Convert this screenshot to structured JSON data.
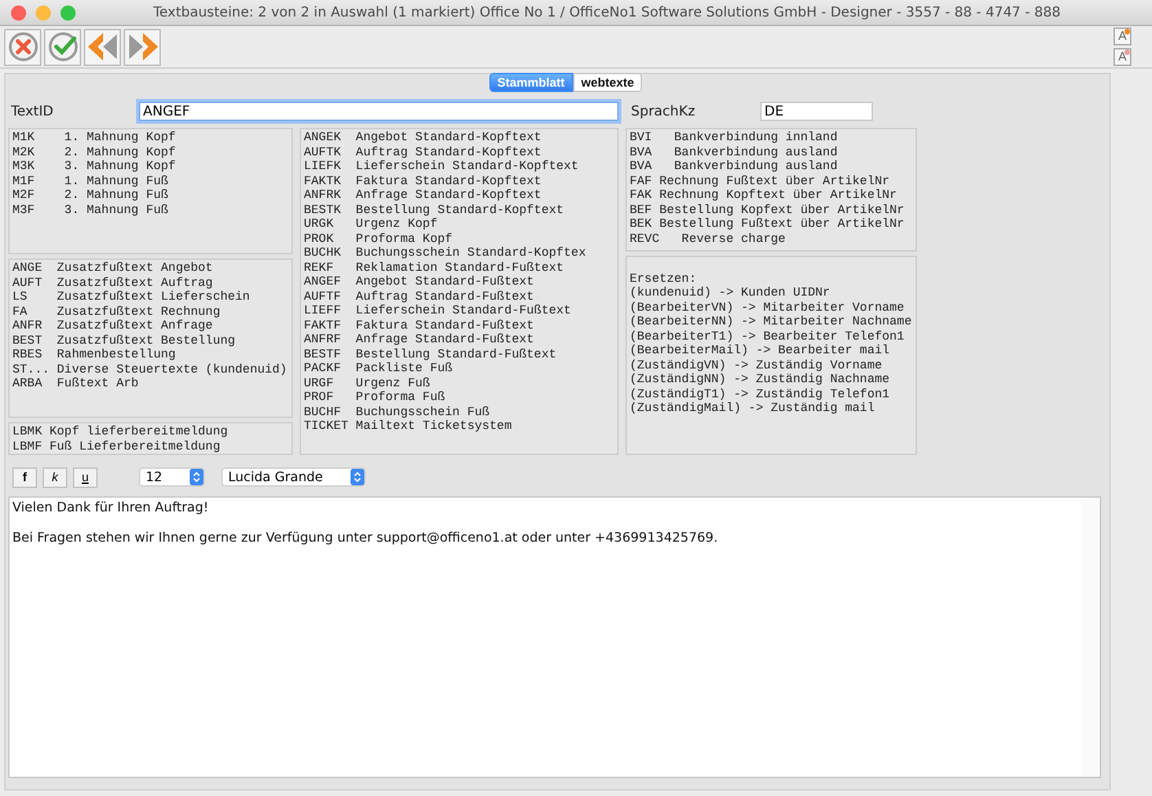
{
  "window": {
    "title": "Textbausteine: 2 von 2 in Auswahl  (1 markiert) Office No 1 /  OfficeNo1 Software Solutions GmbH - Designer - 3557 - 88 - 4747 - 888"
  },
  "toolbar": {
    "actions": [
      {
        "kind": "cancel"
      },
      {
        "kind": "ok"
      },
      {
        "kind": "previous"
      },
      {
        "kind": "next"
      }
    ],
    "font_size_buttons": [
      {
        "label": "A",
        "kind": "increase"
      },
      {
        "label": "A",
        "kind": "decrease"
      }
    ]
  },
  "tabs": [
    {
      "label": "Stammblatt",
      "selected": true
    },
    {
      "label": "webtexte",
      "selected": false
    }
  ],
  "textid": {
    "label": "TextID",
    "value": "ANGEF"
  },
  "sprachkz": {
    "label": "SprachKz",
    "value": "DE"
  },
  "lists": [
    {
      "groups": [
        {
          "lines": [
            "M1K    1. Mahnung Kopf",
            "M2K    2. Mahnung Kopf",
            "M3K    3. Mahnung Kopf",
            "M1F    1. Mahnung Fuß",
            "M2F    2. Mahnung Fuß",
            "M3F    3. Mahnung Fuß"
          ]
        },
        {
          "lines": [
            "ANGE  Zusatzfußtext Angebot",
            "AUFT  Zusatzfußtext Auftrag",
            "LS    Zusatzfußtext Lieferschein",
            "FA    Zusatzfußtext Rechnung",
            "ANFR  Zusatzfußtext Anfrage",
            "BEST  Zusatzfußtext Bestellung",
            "RBES  Rahmenbestellung",
            "ST... Diverse Steuertexte (kundenuid)",
            "ARBA  Fußtext Arb"
          ]
        },
        {
          "lines": [
            "LBMK Kopf lieferbereitmeldung",
            "LBMF Fuß Lieferbereitmeldung"
          ]
        }
      ]
    },
    {
      "groups": [
        {
          "lines": [
            "ANGEK  Angebot Standard-Kopftext",
            "AUFTK  Auftrag Standard-Kopftext",
            "LIEFK  Lieferschein Standard-Kopftext",
            "FAKTK  Faktura Standard-Kopftext",
            "ANFRK  Anfrage Standard-Kopftext",
            "BESTK  Bestellung Standard-Kopftext",
            "URGK   Urgenz Kopf",
            "PROK   Proforma Kopf",
            "BUCHK  Buchungsschein Standard-Kopftex",
            "REKF   Reklamation Standard-Fußtext",
            "ANGEF  Angebot Standard-Fußtext",
            "AUFTF  Auftrag Standard-Fußtext",
            "LIEFF  Lieferschein Standard-Fußtext",
            "FAKTF  Faktura Standard-Fußtext",
            "ANFRF  Anfrage Standard-Fußtext",
            "BESTF  Bestellung Standard-Fußtext",
            "PACKF  Packliste Fuß",
            "URGF   Urgenz Fuß",
            "PROF   Proforma Fuß",
            "BUCHF  Buchungsschein Fuß",
            "TICKET Mailtext Ticketsystem"
          ]
        }
      ]
    },
    {
      "groups": [
        {
          "lines": [
            "BVI   Bankverbindung innland",
            "BVA   Bankverbindung ausland",
            "BVA   Bankverbindung ausland",
            "FAF Rechnung Fußtext über ArtikelNr",
            "FAK Rechnung Kopftext über ArtikelNr",
            "BEF Bestellung Kopfext über ArtikelNr",
            "BEK Bestellung Fußtext über ArtikelNr",
            "REVC   Reverse charge"
          ]
        },
        {
          "lines": [
            "Ersetzen:",
            "(kundenuid) -> Kunden UIDNr",
            "(BearbeiterVN) -> Mitarbeiter Vorname",
            "(BearbeiterNN) -> Mitarbeiter Nachname",
            "(BearbeiterT1) -> Bearbeiter Telefon1",
            "(BearbeiterMail) -> Bearbeiter mail",
            "(ZuständigVN) -> Zuständig Vorname",
            "(ZuständigNN) -> Zuständig Nachname",
            "(ZuständigT1) -> Zuständig Telefon1",
            "(ZuständigMail) -> Zuständig mail"
          ]
        }
      ]
    }
  ],
  "format_bar": {
    "style_buttons": [
      {
        "label": "f",
        "kind": "bold"
      },
      {
        "label": "k",
        "kind": "italic"
      },
      {
        "label": "u",
        "kind": "underline"
      }
    ],
    "size": "12",
    "font": "Lucida Grande"
  },
  "editor": {
    "paragraphs": [
      "Vielen Dank für Ihren Auftrag!",
      "Bei Fragen stehen wir Ihnen gerne zur Verfügung unter support@officeno1.at oder unter +4369913425769."
    ]
  }
}
